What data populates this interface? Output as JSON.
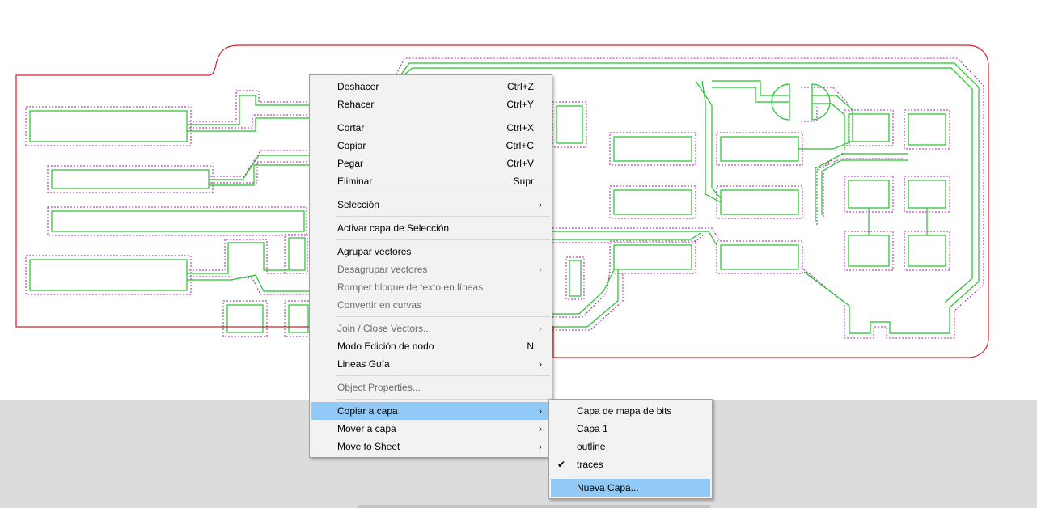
{
  "context_menu": {
    "items": [
      {
        "label": "Deshacer",
        "shortcut": "Ctrl+Z",
        "enabled": true
      },
      {
        "label": "Rehacer",
        "shortcut": "Ctrl+Y",
        "enabled": true
      },
      {
        "label": "Cortar",
        "shortcut": "Ctrl+X",
        "enabled": true
      },
      {
        "label": "Copiar",
        "shortcut": "Ctrl+C",
        "enabled": true
      },
      {
        "label": "Pegar",
        "shortcut": "Ctrl+V",
        "enabled": true
      },
      {
        "label": "Eliminar",
        "shortcut": "Supr",
        "enabled": true
      },
      {
        "label": "Selección",
        "submenu": true,
        "enabled": true
      },
      {
        "label": "Activar capa de Selección",
        "enabled": true
      },
      {
        "label": "Agrupar vectores",
        "enabled": true
      },
      {
        "label": "Desagrupar vectores",
        "submenu": true,
        "enabled": false
      },
      {
        "label": "Romper bloque de texto en líneas",
        "enabled": false
      },
      {
        "label": "Convertir en curvas",
        "enabled": false
      },
      {
        "label": "Join / Close Vectors...",
        "submenu": true,
        "enabled": false
      },
      {
        "label": "Modo Edición de nodo",
        "shortcut": "N",
        "enabled": true
      },
      {
        "label": "Lineas Guía",
        "submenu": true,
        "enabled": true
      },
      {
        "label": "Object Properties...",
        "enabled": false
      },
      {
        "label": "Copiar a capa",
        "submenu": true,
        "enabled": true,
        "highlighted": true
      },
      {
        "label": "Mover a capa",
        "submenu": true,
        "enabled": true
      },
      {
        "label": "Move to Sheet",
        "submenu": true,
        "enabled": true
      }
    ]
  },
  "layer_submenu": {
    "items": [
      {
        "label": "Capa de mapa de bits",
        "checked": false
      },
      {
        "label": "Capa 1",
        "checked": false
      },
      {
        "label": "outline",
        "checked": false
      },
      {
        "label": "traces",
        "checked": true
      },
      {
        "label": "Nueva Capa...",
        "highlighted": true
      }
    ]
  },
  "icons": {
    "submenu_arrow": "chevron-right-icon",
    "checkmark": "check-icon",
    "arrow_glyph": "›",
    "check_glyph": "✔"
  },
  "colors": {
    "outline": "#d0202a",
    "traces": "#22c22a",
    "offset_paths": "#a020a0",
    "menu_bg": "#f2f2f2",
    "highlight": "#91c9f7",
    "disabled_text": "#6d6d6d"
  }
}
